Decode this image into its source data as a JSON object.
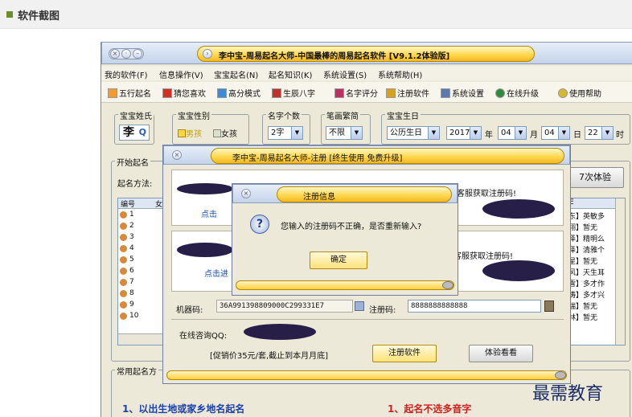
{
  "section_title": "软件截图",
  "window": {
    "title": "李中宝-周易起名大师-中国最棒的周易起名软件 [V9.1.2体验版]",
    "menu": [
      "我的软件(F)",
      "信息操作(V)",
      "宝宝起名(N)",
      "起名知识(K)",
      "系统设置(S)",
      "系统帮助(H)"
    ],
    "toolbar": [
      "五行起名",
      "猜您喜欢",
      "高分模式",
      "生辰八字",
      "名字评分",
      "注册软件",
      "系统设置",
      "在线升级",
      "使用帮助"
    ],
    "toolbar_colors": [
      "#f39b2c",
      "#d42d22",
      "#3c8ad8",
      "#c0312b",
      "#c02f63",
      "#d6a21d",
      "#5a7ab0",
      "#2f8a3e",
      "#d8b630"
    ]
  },
  "form": {
    "surname_legend": "宝宝姓氏",
    "surname": "李",
    "gender_legend": "宝宝性别",
    "boy": "男孩",
    "girl": "女孩",
    "count_legend": "名字个数",
    "count": "2字",
    "stroke_legend": "笔画繁简",
    "stroke": "不限",
    "birth_legend": "宝宝生日",
    "calendar": "公历生日",
    "year": "2017",
    "year_label": "年",
    "month": "04",
    "month_label": "月",
    "day": "04",
    "day_label": "日",
    "hour": "22",
    "hour_label": "时"
  },
  "start_legend": "开始起名",
  "method_label": "起名方法:",
  "trial_btn": "7次体验",
  "table": {
    "col1": "编号",
    "col1b": "女",
    "col_right": "E",
    "rows": [
      "1",
      "2",
      "3",
      "4",
      "5",
      "6",
      "7",
      "8",
      "9",
      "10"
    ],
    "right": [
      "东】英敏多",
      "翔】暂无",
      "泽】精明么",
      "泽】清雅个",
      "星】暂无",
      "风】天生耳",
      "雪】多才作",
      "涛】多才兴",
      "瑞】暂无",
      "林】暂无"
    ]
  },
  "common_legend": "常用起名方",
  "reg_dialog": {
    "title": "李中宝-周易起名大师-注册 [终生使用 免费升级]",
    "contact1": "客服获取注册码!",
    "contact2": "客服获取注册码!",
    "click1": "点击",
    "click2": "点击进",
    "machine_label": "机器码:",
    "machine_code": "36A991398809000C299331E7",
    "reg_label": "注册码:",
    "reg_code": "8888888888888",
    "qq_label": "在线咨询QQ:",
    "promo": "[促销价35元/套,截止到本月月底]",
    "register_btn": "注册软件",
    "trial_btn": "体验看看"
  },
  "info_dialog": {
    "title": "注册信息",
    "message": "您输入的注册码不正确，是否重新输入?",
    "ok": "确定"
  },
  "bottom": {
    "left": "1、以出生地或家乡地名起名",
    "right": "1、起名不选多音字"
  },
  "watermark": "最需教育"
}
